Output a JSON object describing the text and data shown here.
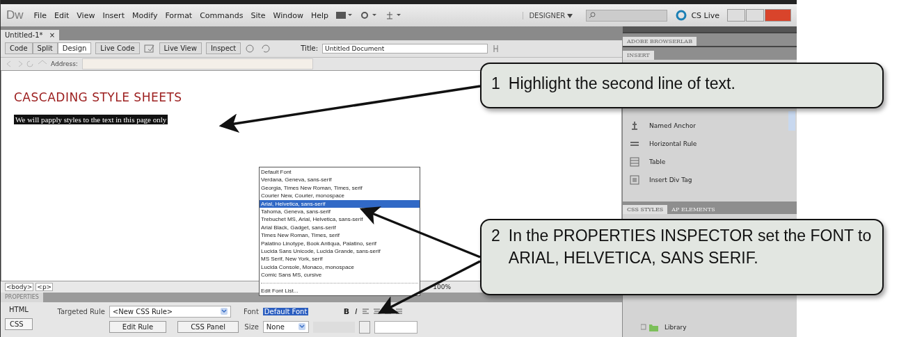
{
  "menu_bar": {
    "logo": "Dw",
    "items": [
      "File",
      "Edit",
      "View",
      "Insert",
      "Modify",
      "Format",
      "Commands",
      "Site",
      "Window",
      "Help"
    ],
    "workspace": "DESIGNER",
    "cs_live": "CS Live"
  },
  "document_tab": {
    "label": "Untitled-1*",
    "close": "×"
  },
  "toolbar": {
    "view_buttons": [
      {
        "label": "Code",
        "selected": false
      },
      {
        "label": "Split",
        "selected": false
      },
      {
        "label": "Design",
        "selected": true
      }
    ],
    "live_code": "Live Code",
    "live_view": "Live View",
    "inspect": "Inspect",
    "title_label": "Title:",
    "title_value": "Untitled Document"
  },
  "address_bar": {
    "label": "Address:"
  },
  "design_view": {
    "heading": "CASCADING STYLE SHEETS",
    "paragraph": "We will papply styles to the text in this page only"
  },
  "tag_selector": {
    "tags": [
      "<body>",
      "<p>"
    ],
    "zoom": "100%"
  },
  "properties": {
    "title": "PROPERTIES",
    "modes": [
      {
        "label": "HTML",
        "selected": false
      },
      {
        "label": "CSS",
        "selected": true
      }
    ],
    "targeted_rule_label": "Targeted Rule",
    "targeted_rule": "<New CSS Rule>",
    "edit_rule": "Edit Rule",
    "css_panel": "CSS Panel",
    "font_label": "Font",
    "font_value": "Default Font",
    "size_label": "Size",
    "size_value": "None",
    "bold": "B",
    "italic": "I"
  },
  "font_dropdown": {
    "items": [
      {
        "label": "Default Font",
        "selected": false
      },
      {
        "label": "Verdana, Geneva, sans-serif",
        "selected": false
      },
      {
        "label": "Georgia, Times New Roman, Times, serif",
        "selected": false
      },
      {
        "label": "Courier New, Courier, monospace",
        "selected": false
      },
      {
        "label": "Arial, Helvetica, sans-serif",
        "selected": true
      },
      {
        "label": "Tahoma, Geneva, sans-serif",
        "selected": false
      },
      {
        "label": "Trebuchet MS, Arial, Helvetica, sans-serif",
        "selected": false
      },
      {
        "label": "Arial Black, Gadget, sans-serif",
        "selected": false
      },
      {
        "label": "Times New Roman, Times, serif",
        "selected": false
      },
      {
        "label": "Palatino Linotype, Book Antiqua, Palatino, serif",
        "selected": false
      },
      {
        "label": "Lucida Sans Unicode, Lucida Grande, sans-serif",
        "selected": false
      },
      {
        "label": "MS Serif, New York, serif",
        "selected": false
      },
      {
        "label": "Lucida Console, Monaco, monospace",
        "selected": false
      },
      {
        "label": "Comic Sans MS, cursive",
        "selected": false
      }
    ],
    "edit_list": "Edit Font List..."
  },
  "right_panels": {
    "browserlab": "ADOBE BROWSERLAB",
    "insert": "INSERT",
    "insert_items": [
      {
        "label": "Named Anchor",
        "kind": "anchor"
      },
      {
        "label": "Horizontal Rule",
        "kind": "rule"
      },
      {
        "label": "Table",
        "kind": "table"
      },
      {
        "label": "Insert Div Tag",
        "kind": "div"
      }
    ],
    "tabs": [
      {
        "label": "CSS STYLES",
        "selected": true
      },
      {
        "label": "AP ELEMENTS",
        "selected": false
      }
    ],
    "files": [
      {
        "label": "Library"
      }
    ]
  },
  "callouts": [
    {
      "number": "1",
      "text": "Highlight the second line of text."
    },
    {
      "number": "2",
      "text": "In the PROPERTIES INSPECTOR set the FONT to ARIAL, HELVETICA, SANS SERIF."
    }
  ]
}
